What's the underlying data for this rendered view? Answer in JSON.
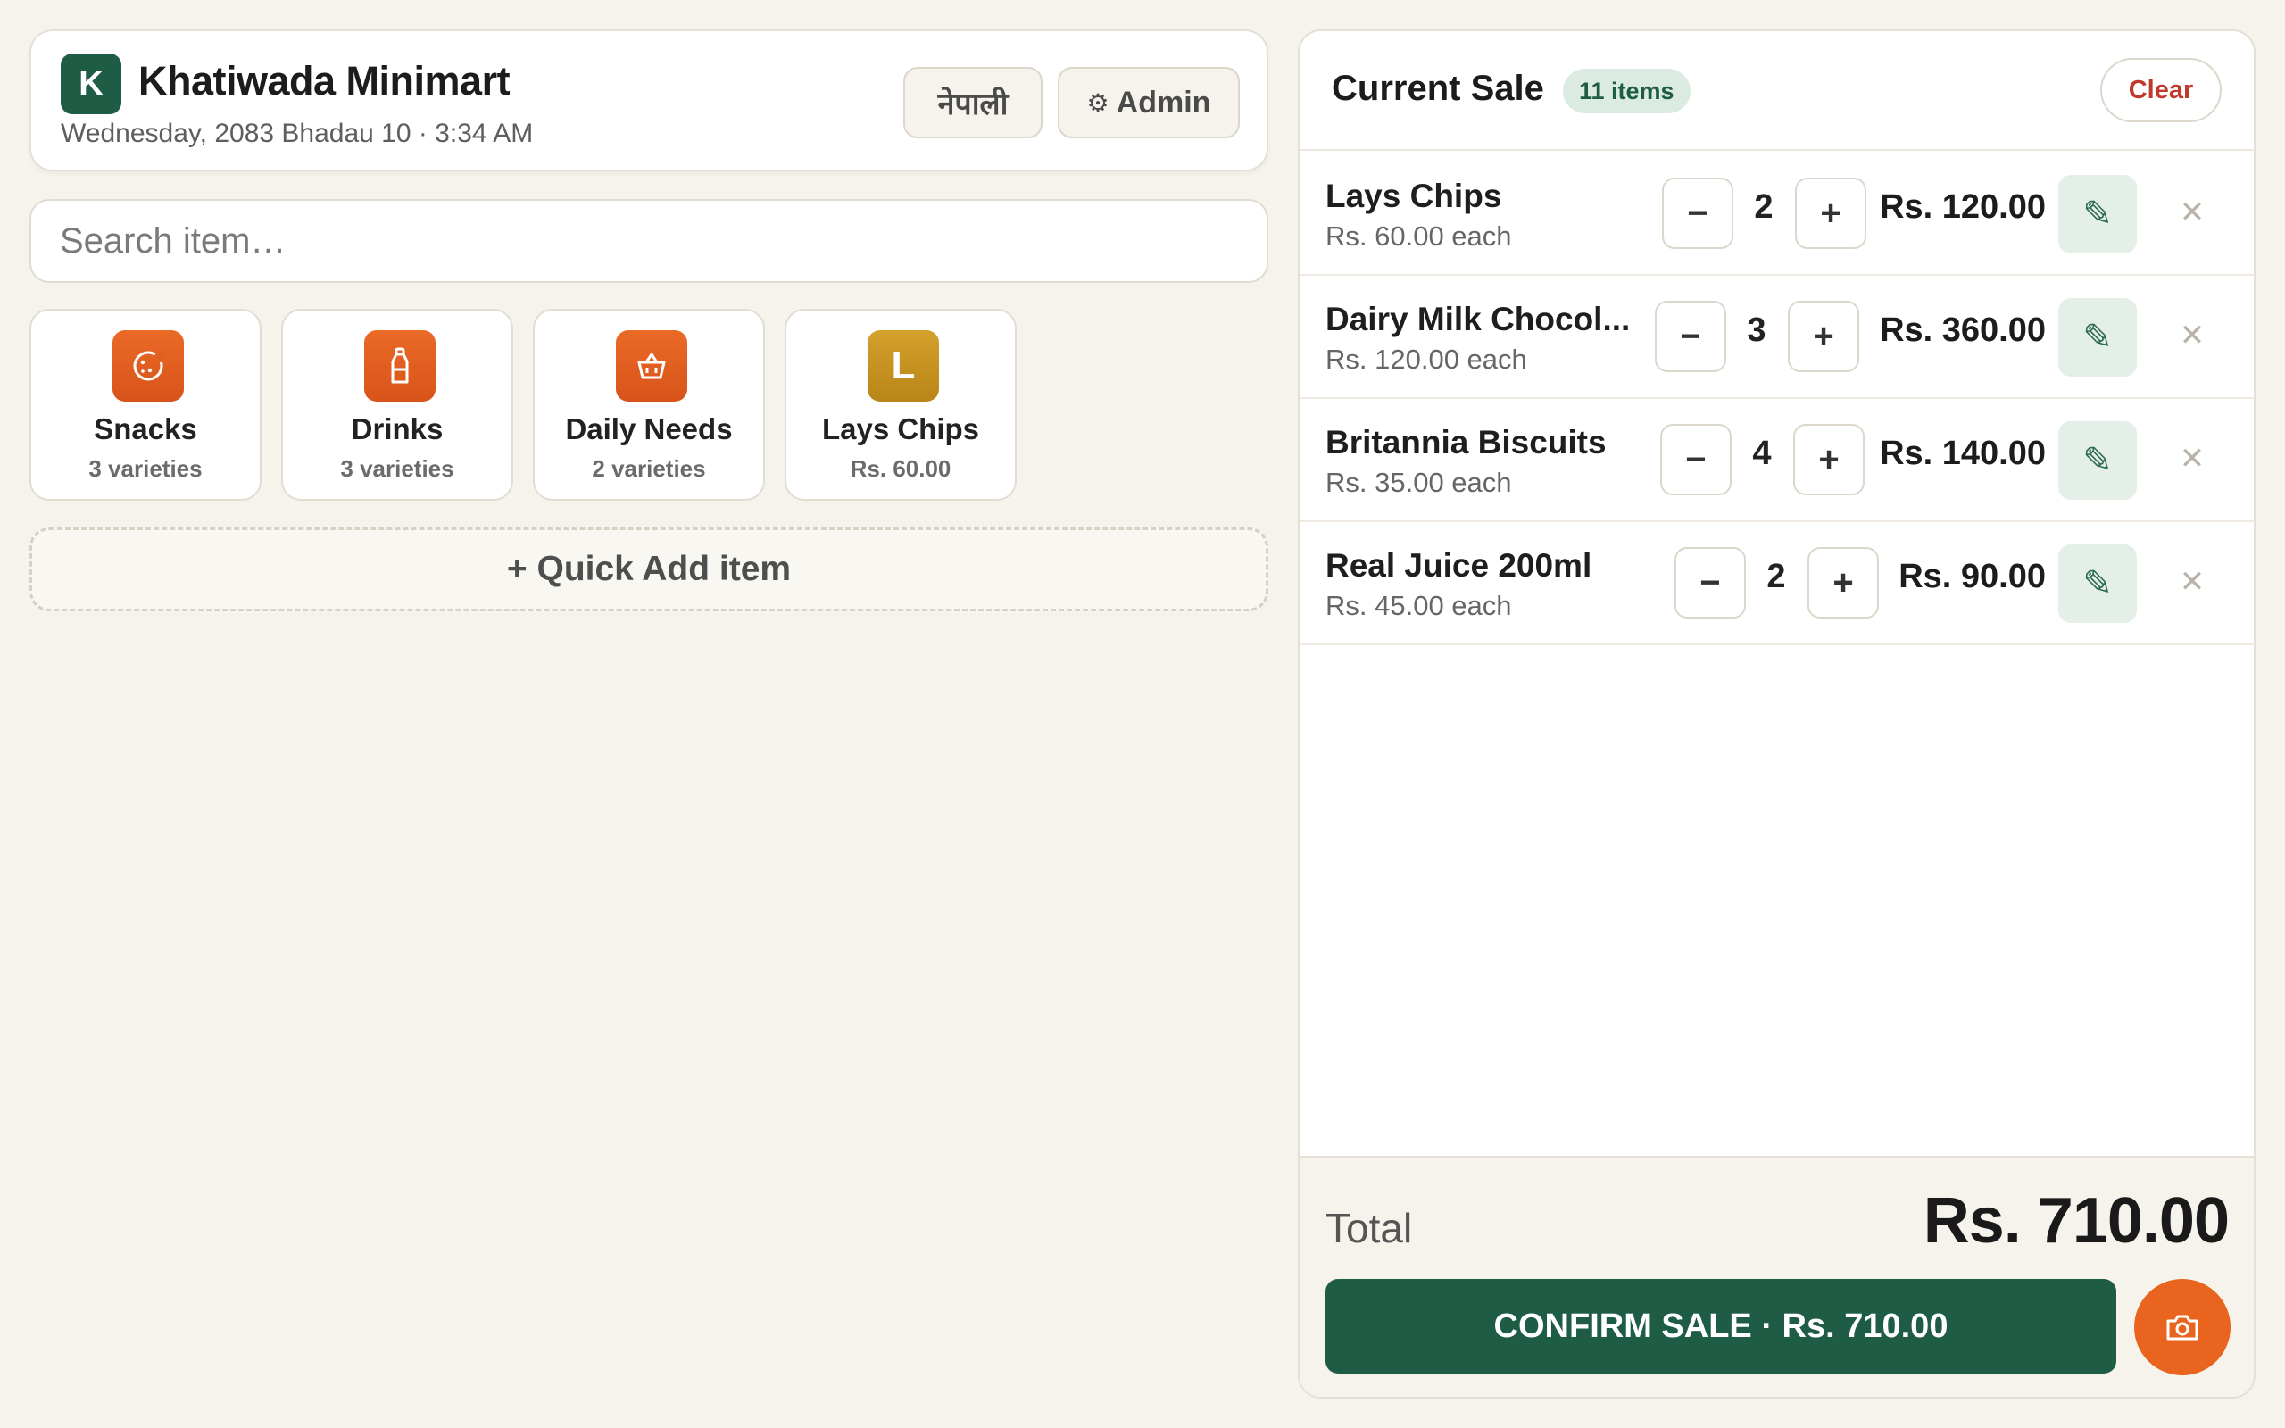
{
  "header": {
    "logo_letter": "K",
    "store_name": "Khatiwada Minimart",
    "date_time": "Wednesday, 2083 Bhadau 10 · 3:34 AM",
    "lang_button": "नेपाली",
    "admin_button": "Admin"
  },
  "search": {
    "placeholder": "Search item…",
    "value": ""
  },
  "categories": [
    {
      "name": "Snacks",
      "sub": "3 varieties",
      "icon": "cookie-icon"
    },
    {
      "name": "Drinks",
      "sub": "3 varieties",
      "icon": "bottle-icon"
    },
    {
      "name": "Daily Needs",
      "sub": "2 varieties",
      "icon": "basket-icon"
    },
    {
      "name": "Lays Chips",
      "sub": "Rs. 60.00",
      "icon_letter": "L"
    }
  ],
  "quick_add_label": "+ Quick Add item",
  "sale": {
    "title": "Current Sale",
    "count_badge": "11 items",
    "clear_label": "Clear",
    "items": [
      {
        "name": "Lays Chips",
        "each": "Rs. 60.00 each",
        "qty": "2",
        "total": "Rs. 120.00"
      },
      {
        "name": "Dairy Milk Chocol...",
        "each": "Rs. 120.00 each",
        "qty": "3",
        "total": "Rs. 360.00"
      },
      {
        "name": "Britannia Biscuits",
        "each": "Rs. 35.00 each",
        "qty": "4",
        "total": "Rs. 140.00"
      },
      {
        "name": "Real Juice 200ml",
        "each": "Rs. 45.00 each",
        "qty": "2",
        "total": "Rs. 90.00"
      }
    ],
    "total_label": "Total",
    "total_value": "Rs. 710.00",
    "confirm_label": "CONFIRM SALE · Rs. 710.00"
  },
  "colors": {
    "brand_green": "#1f5c45",
    "accent_orange": "#e8641f",
    "clear_red": "#c0392b",
    "background": "#f6f3ec"
  }
}
